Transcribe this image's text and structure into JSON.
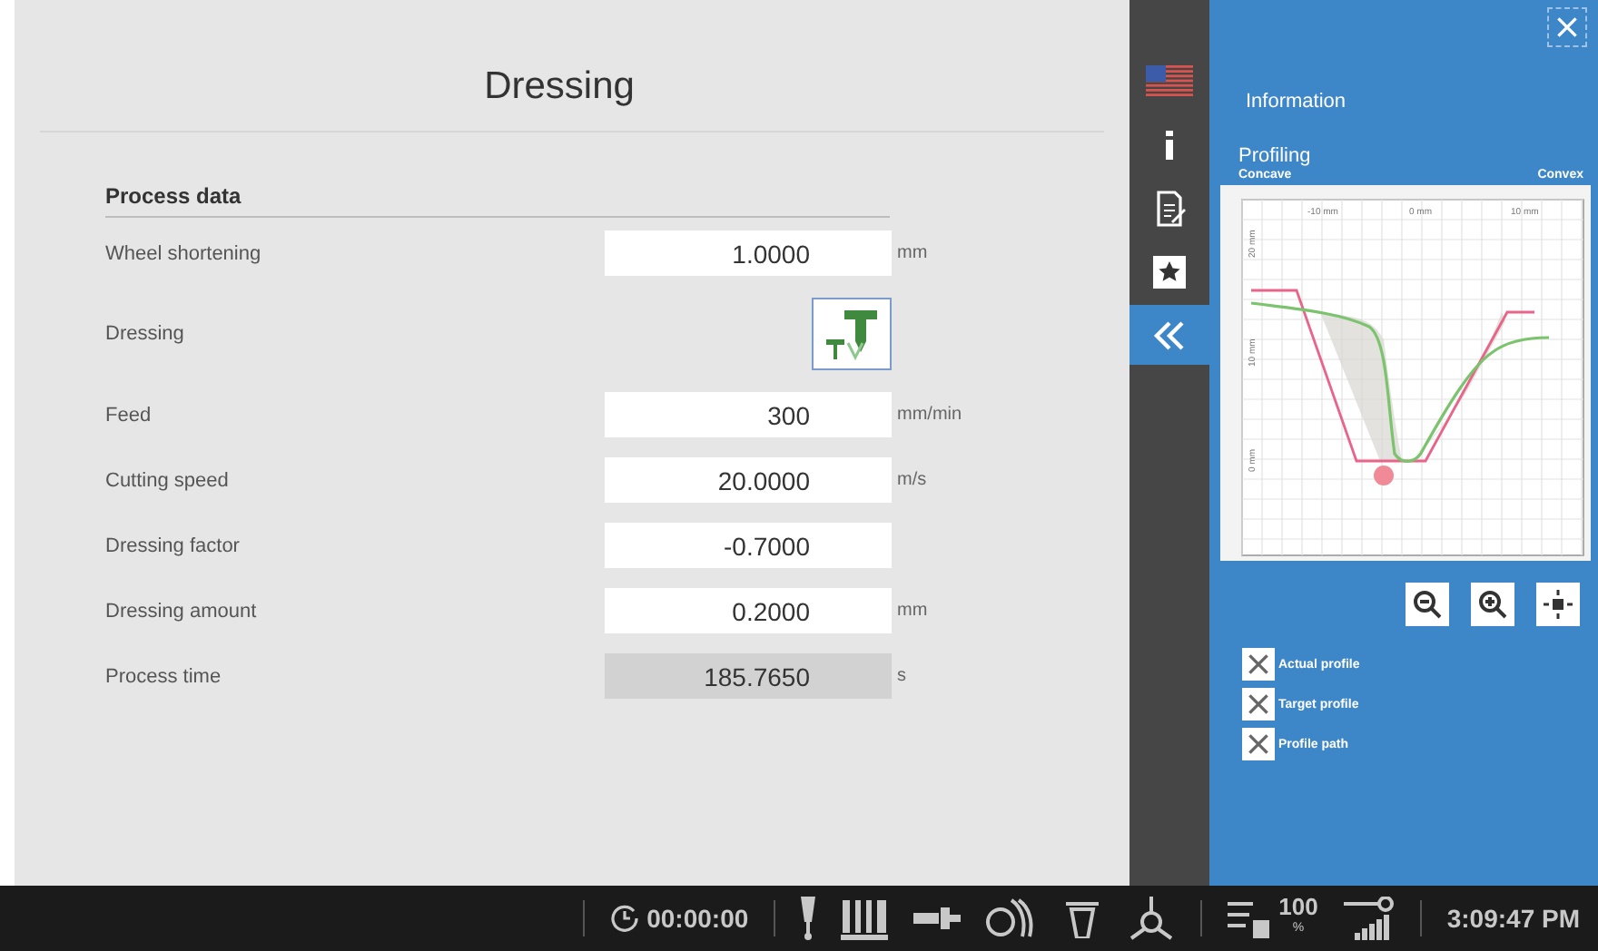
{
  "title": "Dressing",
  "section": "Process data",
  "rows": [
    {
      "kind": "field",
      "label": "Wheel shortening",
      "value": "1.0000",
      "unit": "mm",
      "readonly": false
    },
    {
      "kind": "tool",
      "label": "Dressing"
    },
    {
      "kind": "field",
      "label": "Feed",
      "value": "300",
      "unit": "mm/min",
      "readonly": false
    },
    {
      "kind": "field",
      "label": "Cutting speed",
      "value": "20.0000",
      "unit": "m/s",
      "readonly": false
    },
    {
      "kind": "field",
      "label": "Dressing factor",
      "value": "-0.7000",
      "readonly": false
    },
    {
      "kind": "field",
      "label": "Dressing amount",
      "value": "0.2000",
      "unit": "mm",
      "readonly": false
    },
    {
      "kind": "field",
      "label": "Process time",
      "value": "185.7650",
      "unit": "s",
      "readonly": true
    }
  ],
  "sidebar": [
    {
      "kind": "flag",
      "selected": false
    },
    {
      "kind": "info",
      "selected": false
    },
    {
      "kind": "edit",
      "selected": false
    },
    {
      "kind": "star",
      "selected": false
    },
    {
      "kind": "collapse",
      "selected": true
    }
  ],
  "info": {
    "title": "Information",
    "subtitle": "Profiling",
    "left_label": "Concave",
    "right_label": "Convex",
    "x_ticks": [
      "-10 mm",
      "0 mm",
      "10 mm"
    ],
    "y_ticks": [
      "20 mm",
      "10 mm",
      "0 mm"
    ],
    "options": [
      {
        "label": "Actual profile",
        "checked": true
      },
      {
        "label": "Target profile",
        "checked": true
      },
      {
        "label": "Profile path",
        "checked": true
      }
    ]
  },
  "status_bar": {
    "timer": "00:00:00",
    "override": "100",
    "override_unit": "%",
    "clock": "3:09:47 PM"
  }
}
